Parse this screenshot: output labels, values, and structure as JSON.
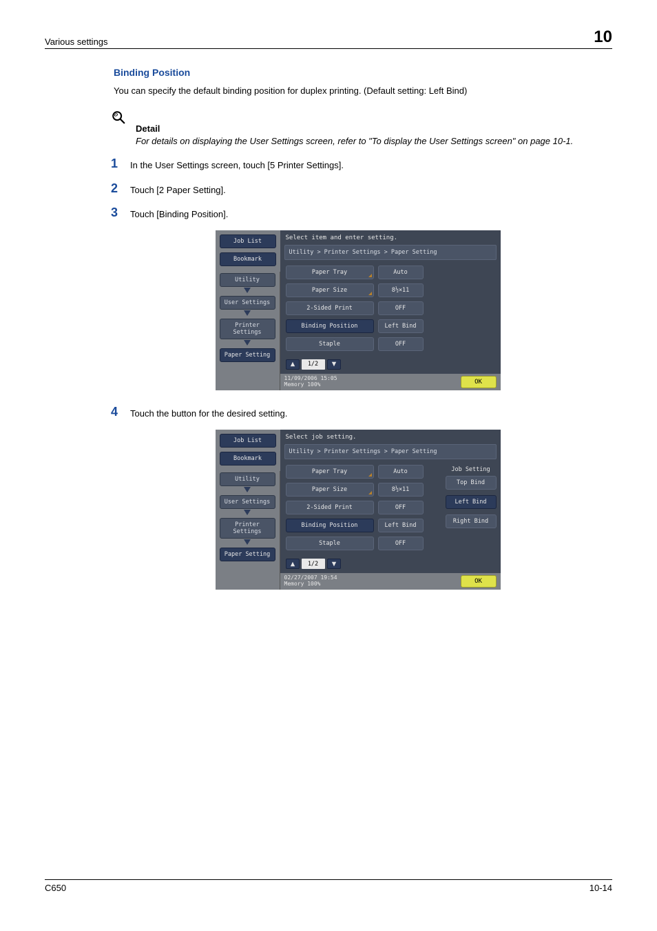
{
  "header": {
    "left": "Various settings",
    "right": "10"
  },
  "section": {
    "title": "Binding Position",
    "intro": "You can specify the default binding position for duplex printing. (Default setting: Left Bind)"
  },
  "detail": {
    "label": "Detail",
    "body": "For details on displaying the User Settings screen, refer to \"To display the User Settings screen\" on page 10-1."
  },
  "steps": [
    {
      "n": "1",
      "t": "In the User Settings screen, touch [5 Printer Settings]."
    },
    {
      "n": "2",
      "t": "Touch [2 Paper Setting]."
    },
    {
      "n": "3",
      "t": "Touch [Binding Position]."
    },
    {
      "n": "4",
      "t": "Touch the button for the desired setting."
    }
  ],
  "panelA": {
    "sidebar_top": [
      "Job List",
      "Bookmark"
    ],
    "sidebar_crumb": [
      "Utility",
      "User Settings",
      "Printer Settings",
      "Paper Setting"
    ],
    "title": "Select item and enter setting.",
    "crumb": "Utility > Printer Settings > Paper Setting",
    "rows": [
      {
        "label": "Paper Tray",
        "val": "Auto",
        "tri": true
      },
      {
        "label": "Paper Size",
        "val": "8½×11",
        "tri": true
      },
      {
        "label": "2-Sided Print",
        "val": "OFF"
      },
      {
        "label": "Binding Position",
        "val": "Left Bind",
        "hl": true
      },
      {
        "label": "Staple",
        "val": "OFF"
      }
    ],
    "pager": "1/2",
    "footer": {
      "l1": "11/09/2006   15:05",
      "l2": "Memory      100%",
      "ok": "OK"
    }
  },
  "panelB": {
    "sidebar_top": [
      "Job List",
      "Bookmark"
    ],
    "sidebar_crumb": [
      "Utility",
      "User Settings",
      "Printer Settings",
      "Paper Setting"
    ],
    "title": "Select job setting.",
    "crumb": "Utility > Printer Settings > Paper Setting",
    "rows": [
      {
        "label": "Paper Tray",
        "val": "Auto",
        "tri": true
      },
      {
        "label": "Paper Size",
        "val": "8½×11",
        "tri": true
      },
      {
        "label": "2-Sided Print",
        "val": "OFF"
      },
      {
        "label": "Binding Position",
        "val": "Left Bind",
        "hl": true
      },
      {
        "label": "Staple",
        "val": "OFF"
      }
    ],
    "right": {
      "title": "Job Setting",
      "items": [
        "Top Bind",
        "Left Bind",
        "Right Bind"
      ],
      "hl_index": 1
    },
    "pager": "1/2",
    "footer": {
      "l1": "02/27/2007   19:54",
      "l2": "Memory      100%",
      "ok": "OK"
    }
  },
  "pageFooter": {
    "left": "C650",
    "right": "10-14"
  }
}
